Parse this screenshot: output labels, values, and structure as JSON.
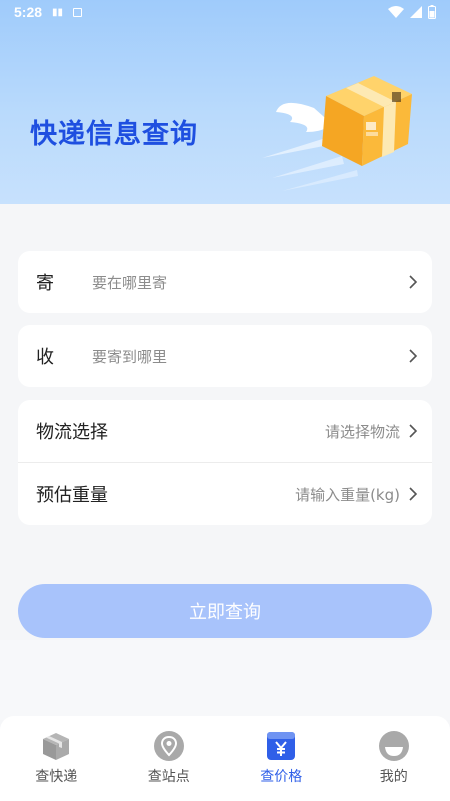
{
  "status_bar": {
    "time": "5:28"
  },
  "hero": {
    "title": "快递信息查询"
  },
  "form": {
    "from": {
      "label": "寄",
      "placeholder": "要在哪里寄"
    },
    "to": {
      "label": "收",
      "placeholder": "要寄到哪里"
    },
    "logistics": {
      "label": "物流选择",
      "placeholder": "请选择物流"
    },
    "weight": {
      "label": "预估重量",
      "placeholder": "请输入重量(kg)"
    },
    "submit_label": "立即查询"
  },
  "tabs": [
    {
      "label": "查快递",
      "icon": "package-icon",
      "active": false
    },
    {
      "label": "查站点",
      "icon": "location-pin-icon",
      "active": false
    },
    {
      "label": "查价格",
      "icon": "yen-price-icon",
      "active": true
    },
    {
      "label": "我的",
      "icon": "profile-icon",
      "active": false
    }
  ],
  "colors": {
    "accent": "#2f5fe8",
    "title": "#1e4fe0",
    "button": "#a8c3fb",
    "hero_top": "#9fcbfb"
  }
}
